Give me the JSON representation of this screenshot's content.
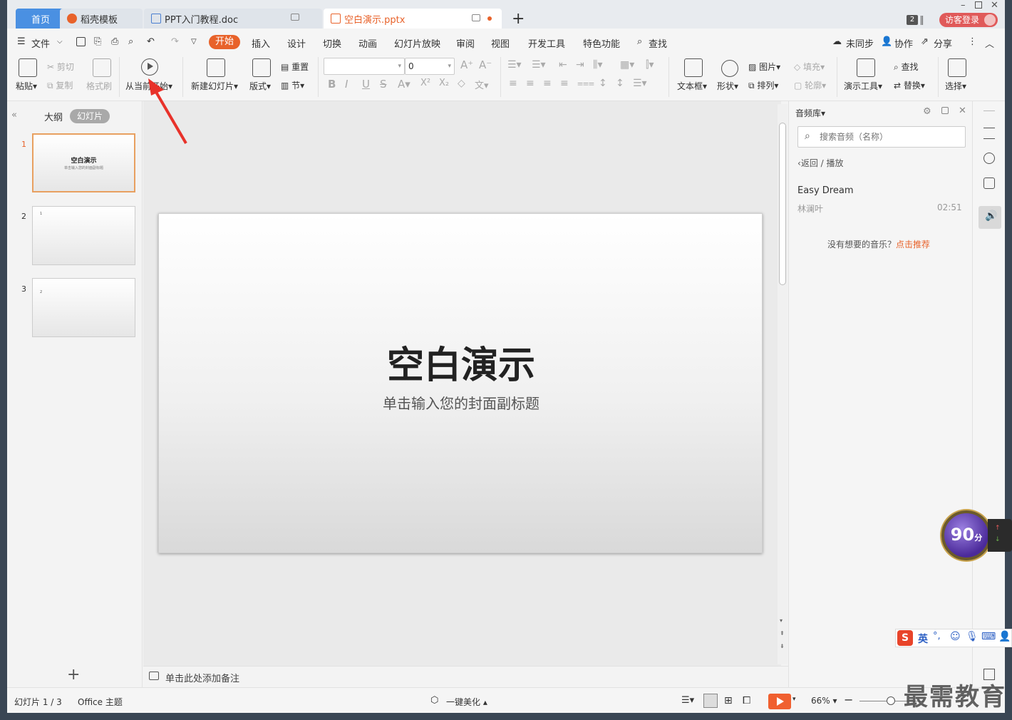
{
  "tabs": {
    "home": "首页",
    "template": "稻壳模板",
    "doc": "PPT入门教程.doc",
    "active": "空白演示.pptx"
  },
  "titlebar": {
    "badge": "2",
    "login": "访客登录"
  },
  "menu": {
    "file": "文件",
    "items": [
      "开始",
      "插入",
      "设计",
      "切换",
      "动画",
      "幻灯片放映",
      "审阅",
      "视图",
      "开发工具",
      "特色功能"
    ],
    "find": "查找",
    "sync": "未同步",
    "collab": "协作",
    "share": "分享"
  },
  "ribbon": {
    "paste": "粘贴",
    "cut": "剪切",
    "copy": "复制",
    "format_painter": "格式刷",
    "play_from_current": "从当前开始",
    "new_slide": "新建幻灯片",
    "layout": "版式",
    "reset": "重置",
    "section": "节",
    "font_size": "0",
    "textbox": "文本框",
    "shape": "形状",
    "picture": "图片",
    "arrange": "排列",
    "fill": "填充",
    "outline": "轮廓",
    "present_tools": "演示工具",
    "find": "查找",
    "replace": "替换",
    "select": "选择"
  },
  "left_panel": {
    "outline_tab": "大纲",
    "slides_tab": "幻灯片",
    "slides": [
      {
        "num": "1",
        "title": "空白演示",
        "sub": "单击输入您的封面副标题"
      },
      {
        "num": "2",
        "title": "1"
      },
      {
        "num": "3",
        "title": "2"
      }
    ]
  },
  "slide": {
    "title": "空白演示",
    "subtitle": "单击输入您的封面副标题"
  },
  "notes": {
    "placeholder": "单击此处添加备注"
  },
  "audio_panel": {
    "title": "音频库",
    "search_placeholder": "搜索音频（名称）",
    "back": "返回",
    "crumb_sep": "/",
    "crumb": "播放",
    "track_title": "Easy Dream",
    "track_artist": "林澜叶",
    "track_duration": "02:51",
    "no_music": "没有想要的音乐？",
    "recommend": "点击推荐"
  },
  "status": {
    "slide_info": "幻灯片 1 / 3",
    "theme": "Office 主题",
    "beautify": "一键美化",
    "zoom": "66%"
  },
  "overlay": {
    "score": "90",
    "score_unit": "分",
    "ime_label": "英",
    "watermark": "最需教育"
  }
}
